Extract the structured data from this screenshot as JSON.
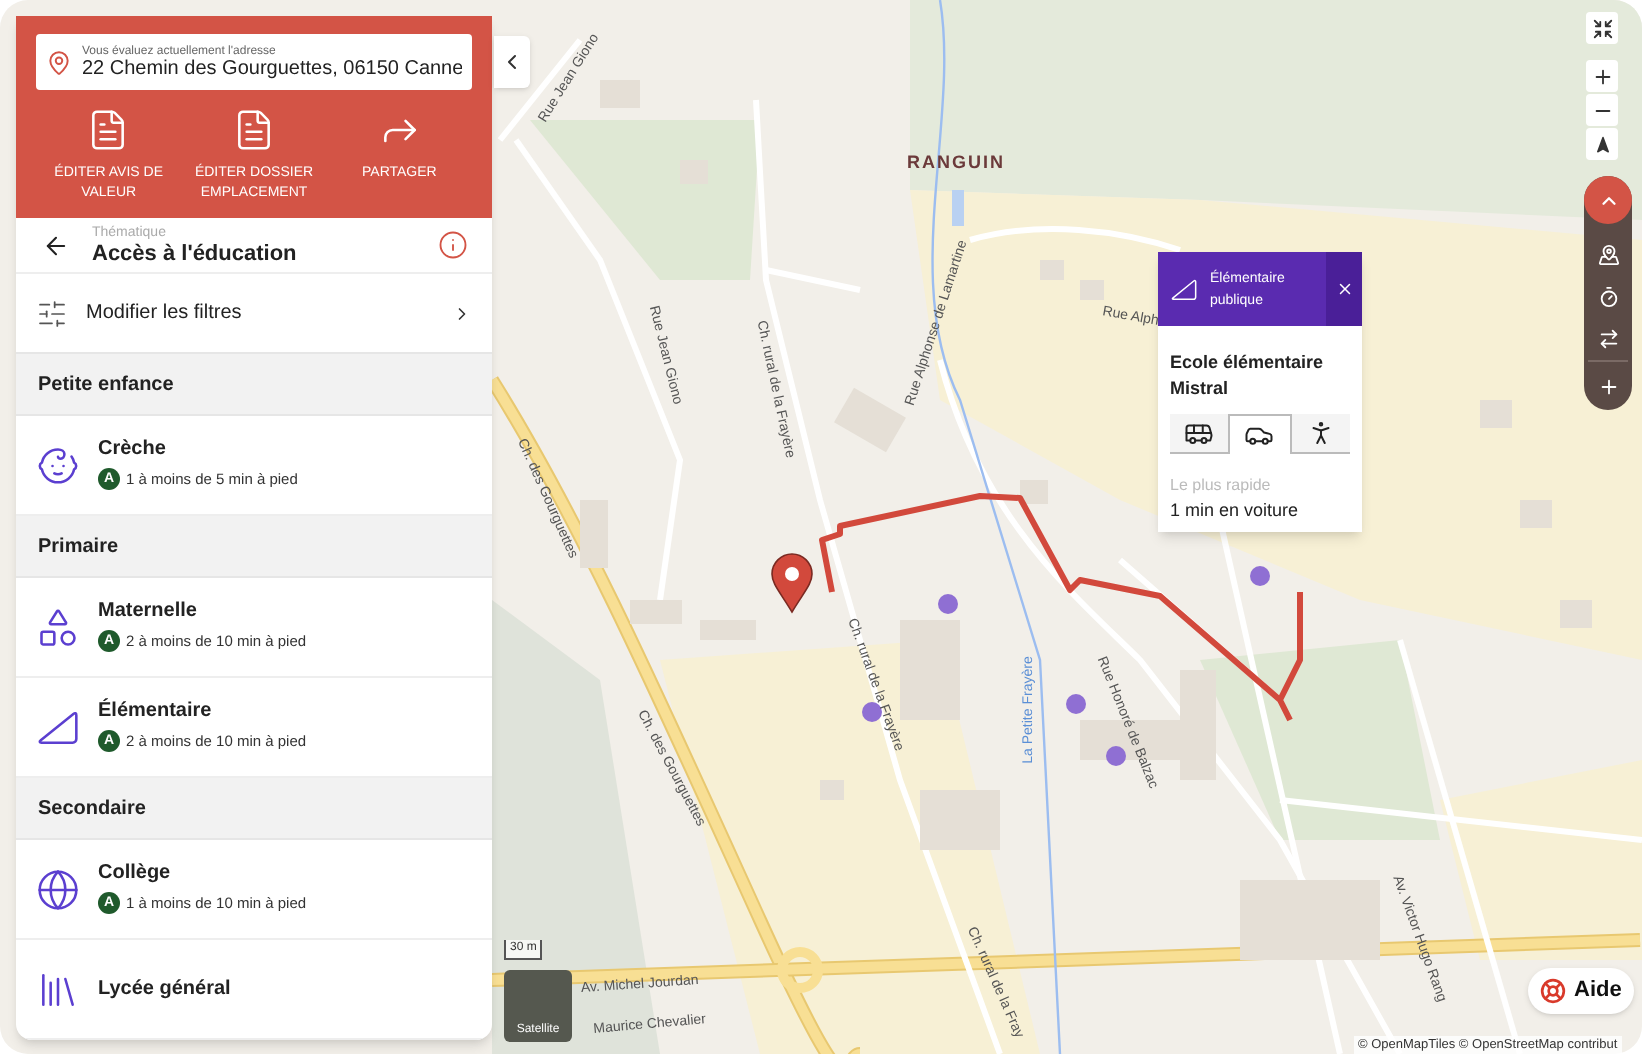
{
  "address": {
    "caption": "Vous évaluez actuellement l'adresse",
    "value": "22 Chemin des Gourguettes, 06150 Canne"
  },
  "actions": [
    {
      "kind": "pdf-home",
      "label": "ÉDITER AVIS DE VALEUR"
    },
    {
      "kind": "pdf-pin",
      "label": "ÉDITER DOSSIER EMPLACEMENT"
    },
    {
      "kind": "share",
      "label": "PARTAGER"
    }
  ],
  "theme": {
    "caption": "Thématique",
    "title": "Accès à l'éducation"
  },
  "filters": {
    "label": "Modifier les filtres"
  },
  "sections": [
    {
      "title": "Petite enfance",
      "items": [
        {
          "kind": "creche",
          "name": "Crèche",
          "grade": "A",
          "detail": "1 à moins de 5 min à pied"
        }
      ]
    },
    {
      "title": "Primaire",
      "items": [
        {
          "kind": "maternelle",
          "name": "Maternelle",
          "grade": "A",
          "detail": "2 à moins de 10 min à pied"
        },
        {
          "kind": "elementaire",
          "name": "Élémentaire",
          "grade": "A",
          "detail": "2 à moins de 10 min à pied"
        }
      ]
    },
    {
      "title": "Secondaire",
      "items": [
        {
          "kind": "college",
          "name": "Collège",
          "grade": "A",
          "detail": "1 à moins de 10 min à pied"
        },
        {
          "kind": "lycee",
          "name": "Lycée général"
        }
      ]
    }
  ],
  "popup": {
    "category": "Élémentaire publique",
    "name": "Ecole élémentaire Mistral",
    "caption": "Le plus rapide",
    "result": "1 min en voiture",
    "modes": [
      {
        "kind": "bus",
        "selected": false
      },
      {
        "kind": "car",
        "selected": true
      },
      {
        "kind": "walk",
        "selected": false
      }
    ]
  },
  "map_labels": [
    {
      "kind": "place",
      "text": "RANGUIN"
    },
    {
      "kind": "street",
      "text": "Rue Jean Giono"
    },
    {
      "kind": "street",
      "text": "Rue Jean Giono"
    },
    {
      "kind": "street",
      "text": "Ch. rural de la Frayère"
    },
    {
      "kind": "street",
      "text": "Ch. rural de la Frayère"
    },
    {
      "kind": "street",
      "text": "Ch. des Gourguettes"
    },
    {
      "kind": "street",
      "text": "Ch. des Gourguettes"
    },
    {
      "kind": "street",
      "text": "Rue Alphonse de Lamartine"
    },
    {
      "kind": "street",
      "text": "Rue Alph"
    },
    {
      "kind": "stream",
      "text": "La Petite Frayère"
    },
    {
      "kind": "street",
      "text": "Rue Honoré de Balzac"
    },
    {
      "kind": "street",
      "text": "Av. Michel Jourdan"
    },
    {
      "kind": "street",
      "text": "Maurice Chevalier"
    },
    {
      "kind": "street",
      "text": "Ch. rural de la Fray"
    },
    {
      "kind": "street",
      "text": "Av. Victor Hugo Rang"
    }
  ],
  "scale": "30 m",
  "satellite": "Satellite",
  "help": "Aide",
  "attribution": "© OpenMapTiles © OpenStreetMap contribut"
}
